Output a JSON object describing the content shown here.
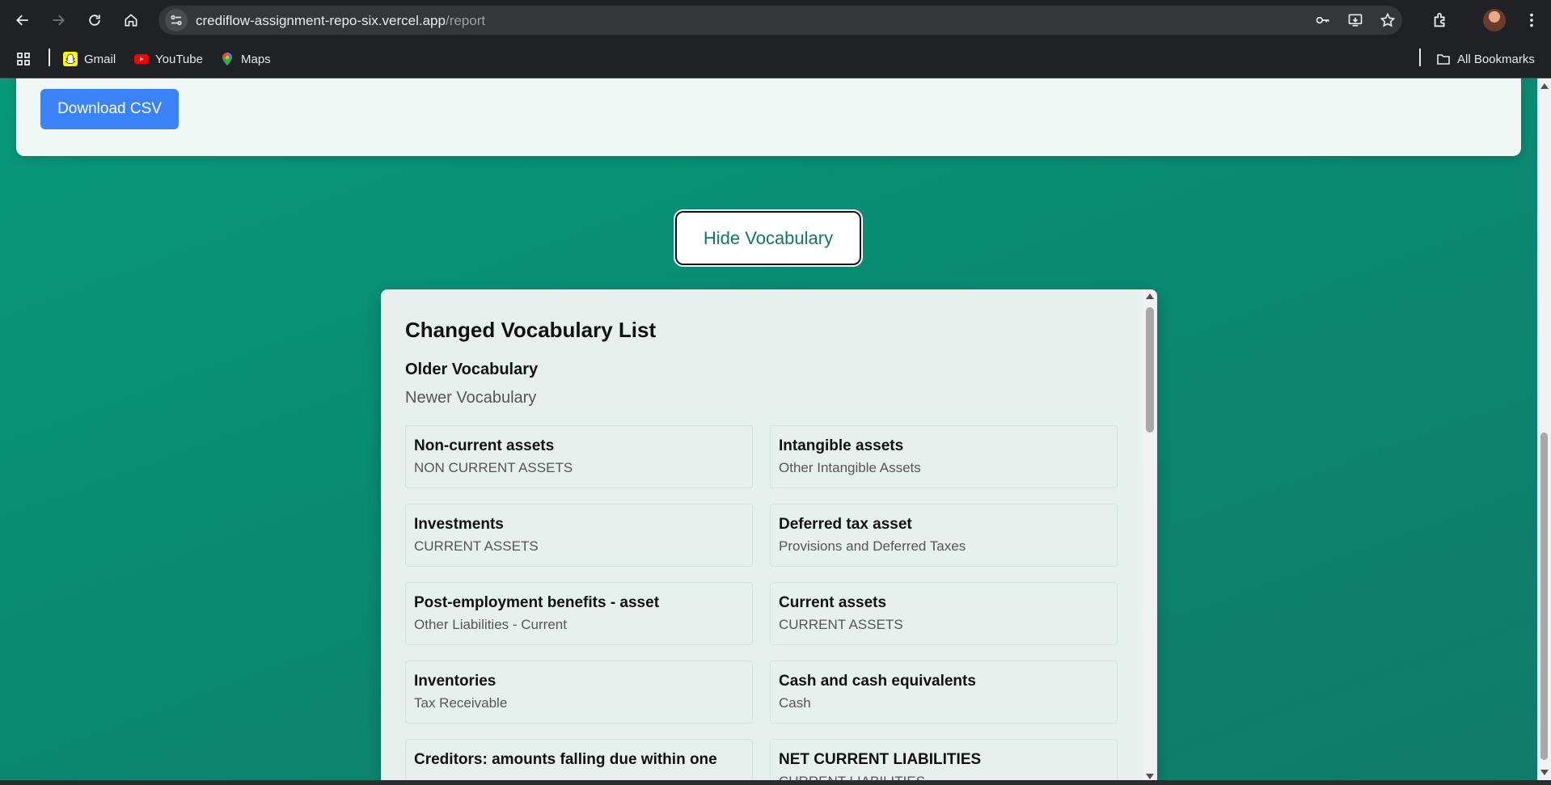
{
  "browser": {
    "url_host": "crediflow-assignment-repo-six.vercel.app",
    "url_path": "/report",
    "bookmarks": [
      {
        "label": "Gmail",
        "icon": "snapchat-icon"
      },
      {
        "label": "YouTube",
        "icon": "youtube-icon"
      },
      {
        "label": "Maps",
        "icon": "maps-pin-icon"
      }
    ],
    "all_bookmarks_label": "All Bookmarks"
  },
  "actions": {
    "download_csv_label": "Download CSV",
    "hide_vocabulary_label": "Hide Vocabulary"
  },
  "vocabulary": {
    "title": "Changed Vocabulary List",
    "legend_older": "Older Vocabulary",
    "legend_newer": "Newer Vocabulary",
    "items": [
      {
        "older": "Non-current assets",
        "newer": "NON CURRENT ASSETS"
      },
      {
        "older": "Intangible assets",
        "newer": "Other Intangible Assets"
      },
      {
        "older": "Investments",
        "newer": "CURRENT ASSETS"
      },
      {
        "older": "Deferred tax asset",
        "newer": "Provisions and Deferred Taxes"
      },
      {
        "older": "Post-employment benefits - asset",
        "newer": "Other Liabilities - Current"
      },
      {
        "older": "Current assets",
        "newer": "CURRENT ASSETS"
      },
      {
        "older": "Inventories",
        "newer": "Tax Receivable"
      },
      {
        "older": "Cash and cash equivalents",
        "newer": "Cash"
      },
      {
        "older": "Creditors: amounts falling due within one",
        "newer": ""
      },
      {
        "older": "NET CURRENT LIABILITIES",
        "newer": "CURRENT LIABILITIES"
      }
    ]
  },
  "colors": {
    "page_gradient_start": "#08997a",
    "page_gradient_end": "#107b6a",
    "csv_button": "#3b82f6",
    "hide_button_text": "#0d7a5f",
    "panel_bg": "#e6f1ee"
  }
}
